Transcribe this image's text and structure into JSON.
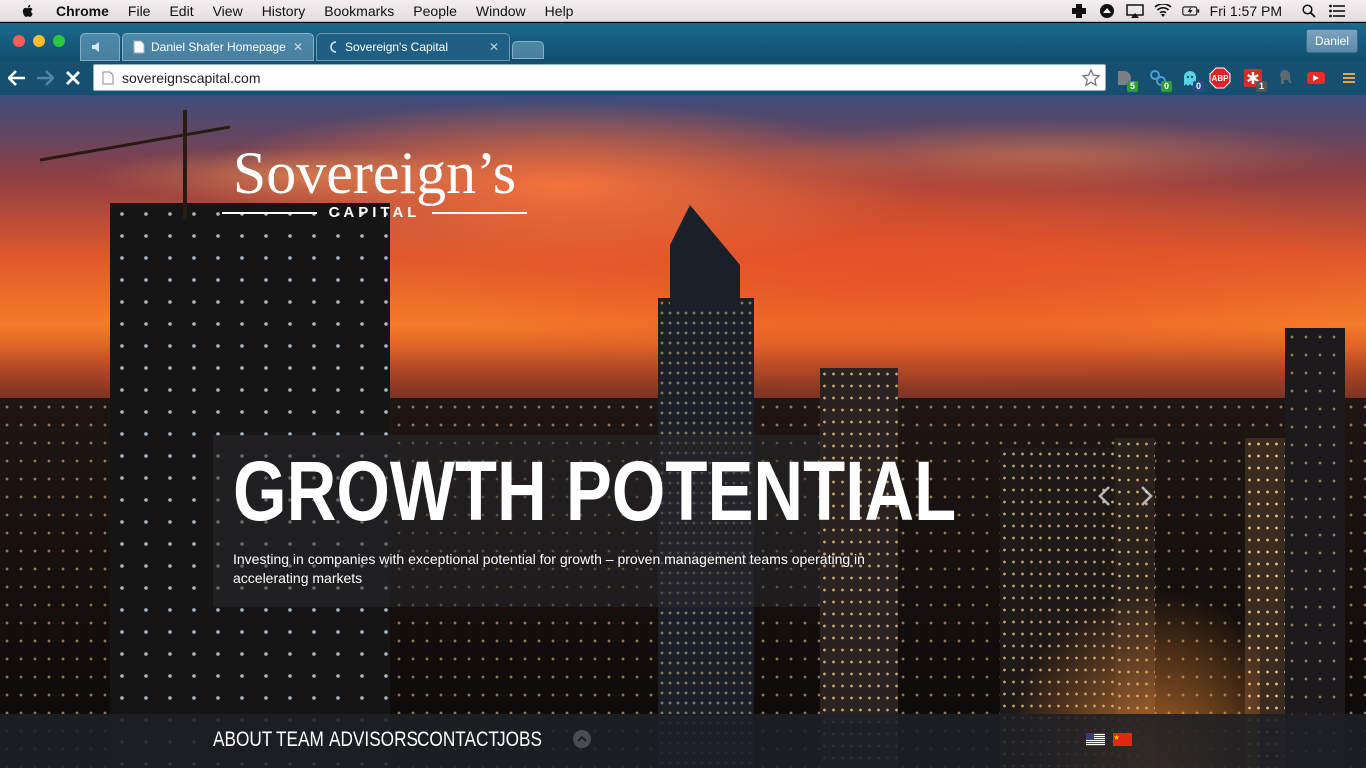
{
  "menubar": {
    "app": "Chrome",
    "items": [
      "File",
      "Edit",
      "View",
      "History",
      "Bookmarks",
      "People",
      "Window",
      "Help"
    ],
    "clock": "Fri 1:57 PM"
  },
  "tabs": [
    {
      "label": "Daniel Shafer Homepage",
      "active": false
    },
    {
      "label": "Sovereign's Capital",
      "active": true
    }
  ],
  "profile": {
    "name": "Daniel"
  },
  "omnibox": {
    "url": "sovereignscapital.com"
  },
  "extensions": [
    {
      "icon": "extension-d-icon",
      "badge": "5"
    },
    {
      "icon": "extension-b-icon",
      "badge": "0"
    },
    {
      "icon": "ghost-icon",
      "badge": "0"
    },
    {
      "icon": "adblock-icon",
      "label": "ABP"
    },
    {
      "icon": "lastpass-icon",
      "badge": "1"
    },
    {
      "icon": "elephant-icon"
    },
    {
      "icon": "youtube-icon"
    },
    {
      "icon": "menu-icon"
    }
  ],
  "site": {
    "logo": {
      "name": "Sovereign’s",
      "sub": "CAPITAL"
    },
    "hero": {
      "title": "GROWTH POTENTIAL",
      "text": "Investing in companies with exceptional potential for growth – proven management teams operating in accelerating markets"
    },
    "nav": [
      "ABOUT",
      "TEAM",
      "ADVISORS",
      "CONTACT",
      "JOBS"
    ],
    "languages": [
      "en-us-flag-icon",
      "zh-cn-flag-icon"
    ]
  }
}
